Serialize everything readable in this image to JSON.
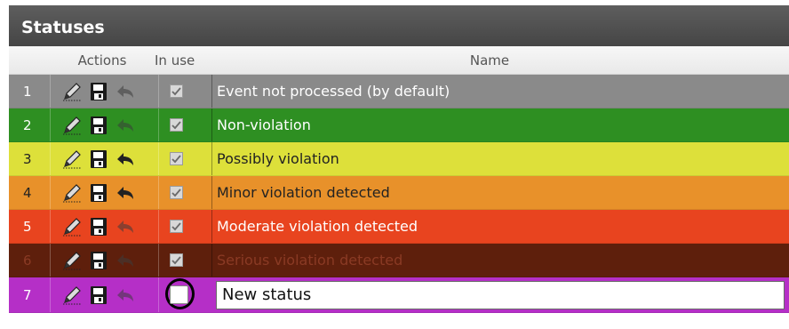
{
  "panel": {
    "title": "Statuses"
  },
  "columns": {
    "actions": "Actions",
    "in_use": "In use",
    "name": "Name"
  },
  "icons": {
    "edit": "pencil-icon",
    "save": "floppy-disk-icon",
    "undo": "undo-arrow-icon",
    "in_use": "checkbox"
  },
  "rows": [
    {
      "num": "1",
      "name": "Event not processed (by default)",
      "in_use": true,
      "bg": "#8a8a8a",
      "text_color": "#ffffff"
    },
    {
      "num": "2",
      "name": "Non-violation",
      "in_use": true,
      "bg": "#2e8f22",
      "text_color": "#ffffff"
    },
    {
      "num": "3",
      "name": "Possibly violation",
      "in_use": true,
      "bg": "#dde03a",
      "text_color": "#222222"
    },
    {
      "num": "4",
      "name": "Minor violation detected",
      "in_use": true,
      "bg": "#e8912a",
      "text_color": "#222222"
    },
    {
      "num": "5",
      "name": "Moderate violation detected",
      "in_use": true,
      "bg": "#e8441f",
      "text_color": "#ffffff"
    },
    {
      "num": "6",
      "name": "Serious violation detected",
      "in_use": true,
      "bg": "#5e1f0c",
      "text_color": "#8a3a24"
    }
  ],
  "new_row": {
    "num": "7",
    "input_value": "New status",
    "in_use": false,
    "bg": "#b52fc7",
    "text_color": "#ffffff"
  }
}
